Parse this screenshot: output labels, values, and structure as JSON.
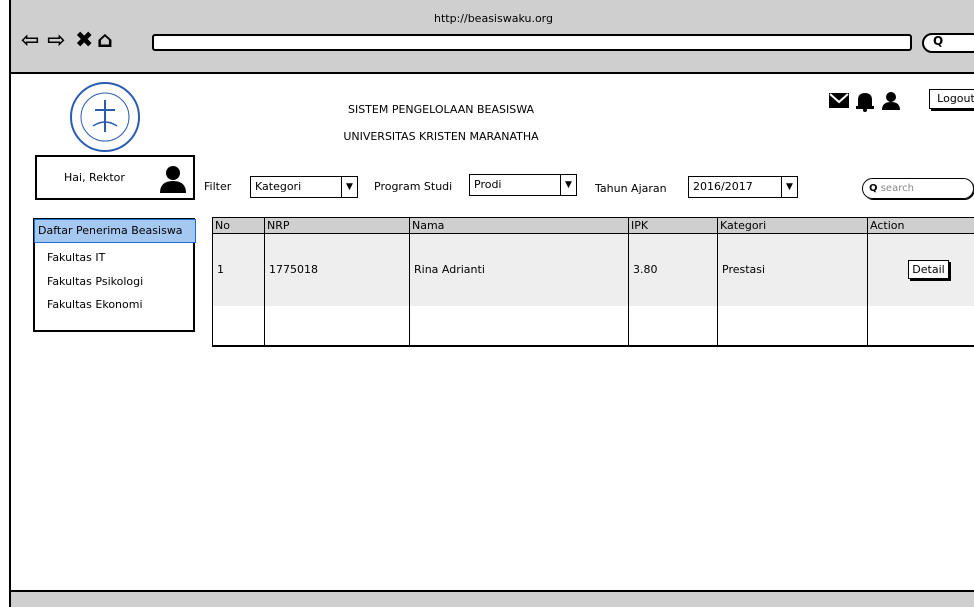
{
  "browser": {
    "url": "http://beasiswaku.org",
    "search_icon": "search-icon"
  },
  "header": {
    "title_line1": "SISTEM PENGELOLAAN BEASISWA",
    "title_line2": "UNIVERSITAS KRISTEN MARANATHA",
    "logout": "Logout"
  },
  "user": {
    "greeting": "Hai, Rektor"
  },
  "filters": {
    "filter_label": "Filter",
    "kategori_value": "Kategori",
    "prodi_label": "Program Studi",
    "prodi_value": "Prodi",
    "tahun_label": "Tahun Ajaran",
    "tahun_value": "2016/2017",
    "search_placeholder": "search"
  },
  "sidebar": {
    "items": [
      {
        "label": "Daftar Penerima Beasiswa"
      },
      {
        "label": "Fakultas IT"
      },
      {
        "label": "Fakultas Psikologi"
      },
      {
        "label": "Fakultas Ekonomi"
      }
    ]
  },
  "table": {
    "headers": [
      "No",
      "NRP",
      "Nama",
      "IPK",
      "Kategori",
      "Action"
    ],
    "rows": [
      {
        "no": "1",
        "nrp": "1775018",
        "nama": "Rina Adrianti",
        "ipk": "3.80",
        "kategori": "Prestasi",
        "action": "Detail"
      }
    ]
  }
}
